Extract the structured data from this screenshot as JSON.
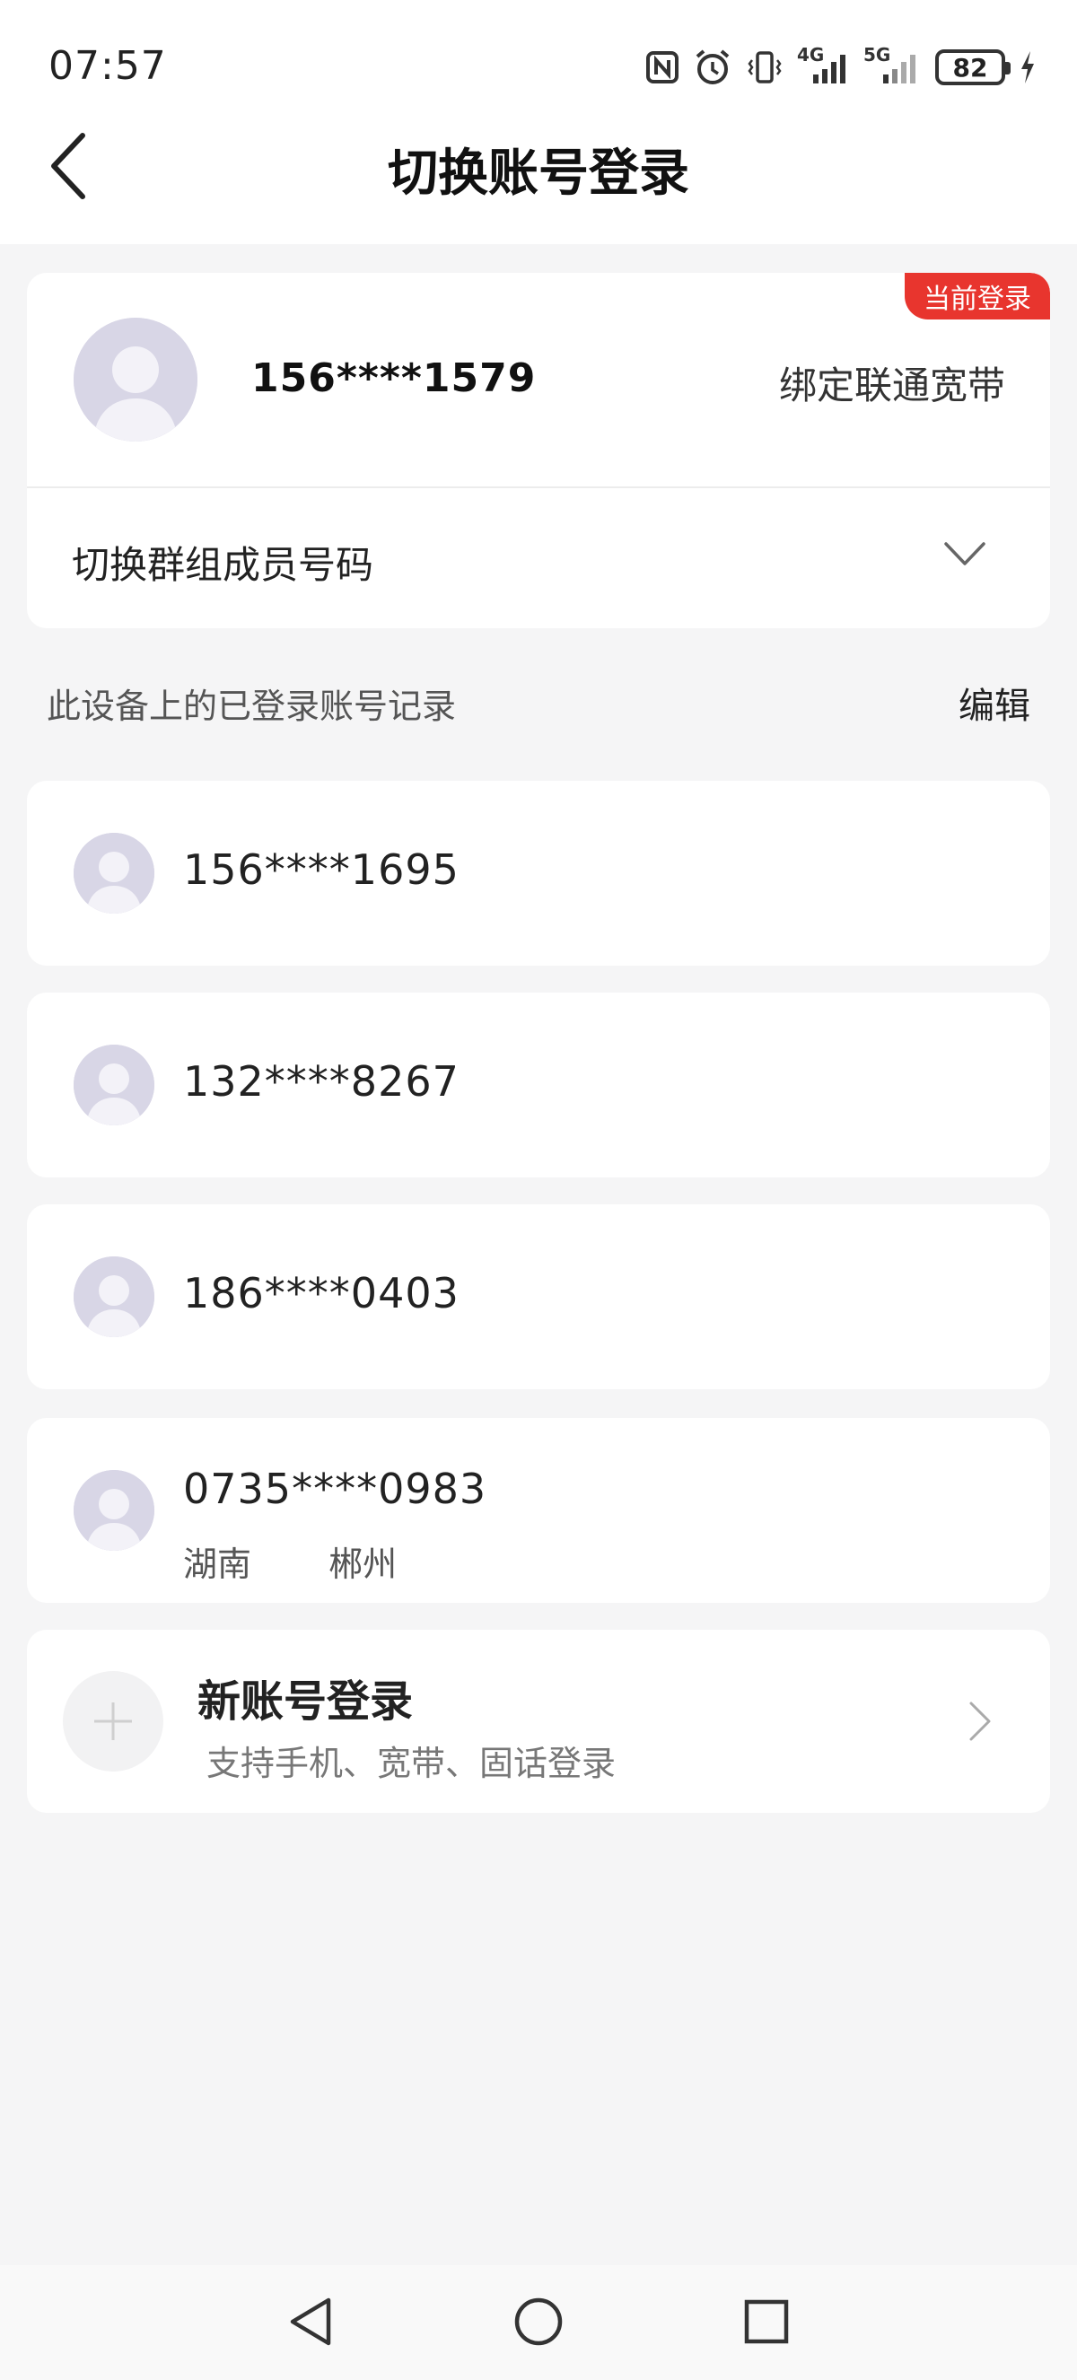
{
  "status_bar": {
    "time": "07:57",
    "battery_level": "82",
    "icons": [
      "nfc-icon",
      "alarm-icon",
      "vibrate-icon",
      "signal-4g-icon",
      "signal-5g-icon",
      "battery-icon",
      "charging-icon"
    ],
    "network_labels": [
      "4G",
      "5G"
    ]
  },
  "header": {
    "title": "切换账号登录",
    "back_icon": "chevron-left-icon"
  },
  "current_account": {
    "badge": "当前登录",
    "number": "156****1579",
    "bind_label": "绑定联通宽带",
    "group_switch_label": "切换群组成员号码"
  },
  "history": {
    "title": "此设备上的已登录账号记录",
    "edit_label": "编辑",
    "accounts": [
      {
        "number": "156****1695"
      },
      {
        "number": "132****8267"
      },
      {
        "number": "186****0403"
      },
      {
        "number": "0735****0983",
        "province": "湖南",
        "city": "郴州"
      }
    ]
  },
  "new_account": {
    "title": "新账号登录",
    "subtitle": "支持手机、宽带、固话登录"
  },
  "colors": {
    "accent_red": "#e8352e",
    "avatar_bg": "#d8d6e6",
    "page_bg": "#f5f5f6"
  }
}
